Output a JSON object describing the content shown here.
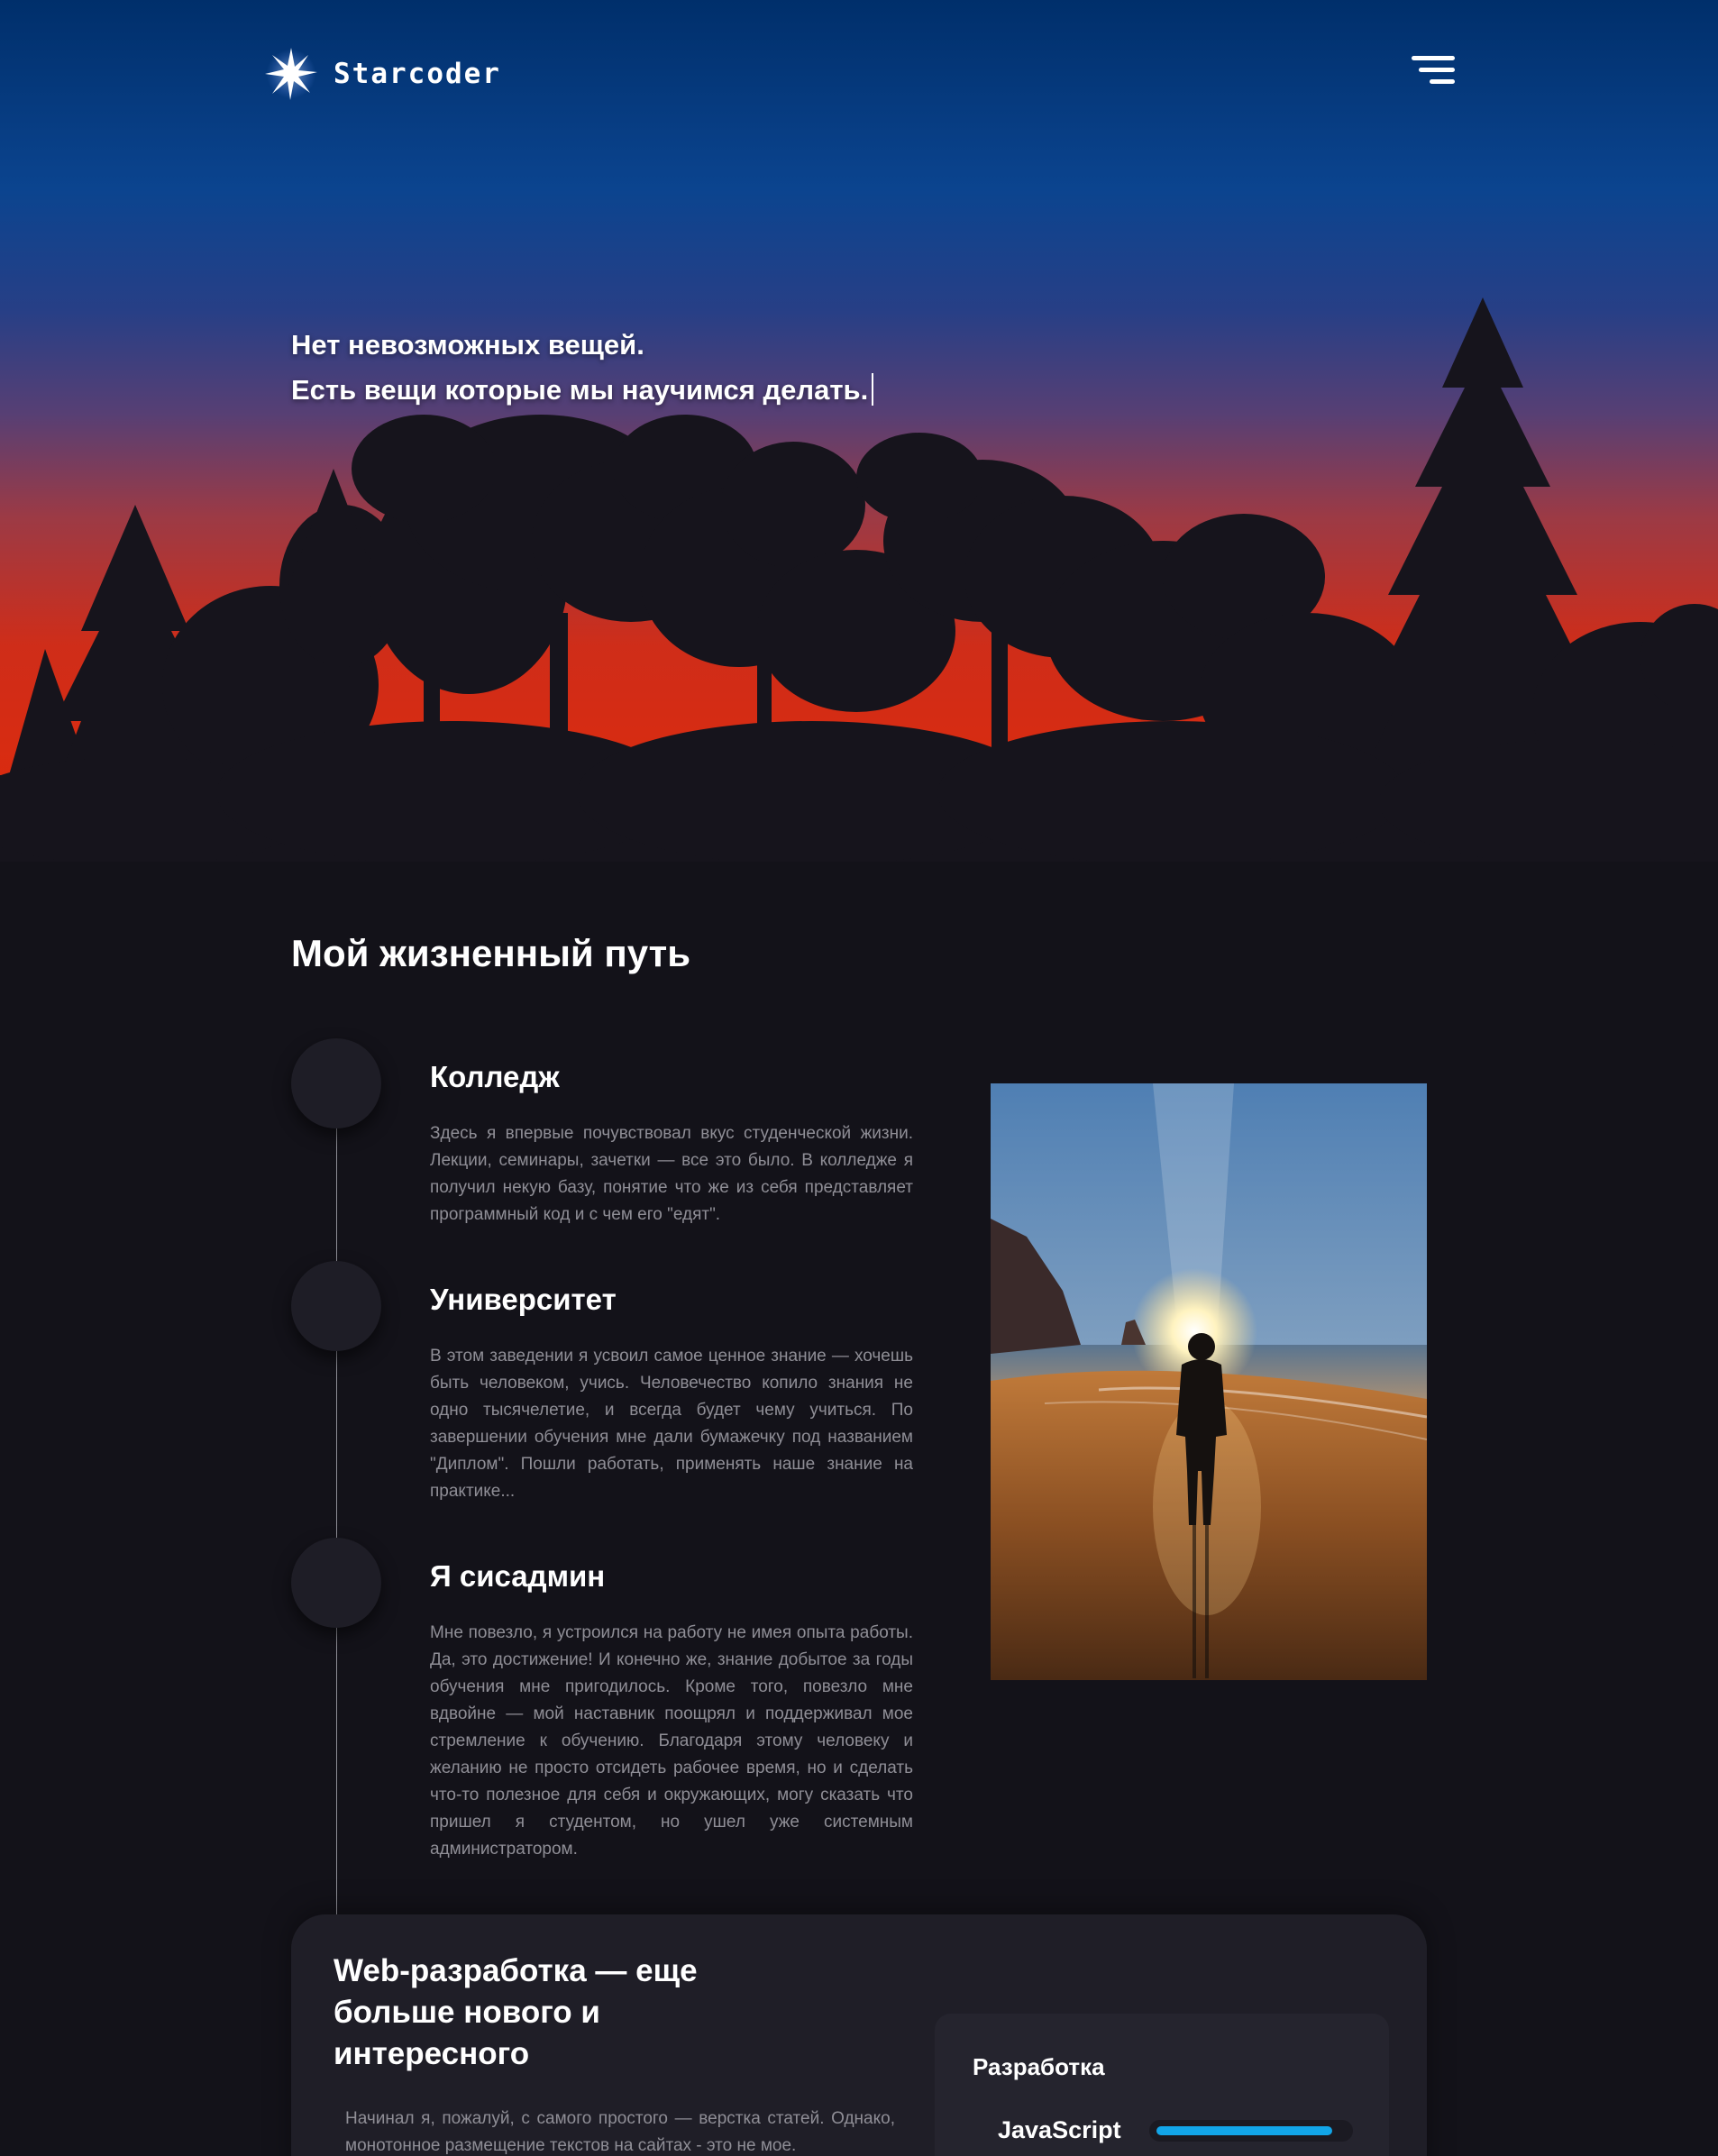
{
  "header": {
    "logo_text": "Starcoder",
    "logo_icon": "star-burst-icon",
    "menu_icon": "hamburger-menu-icon"
  },
  "hero": {
    "line1": "Нет невозможных вещей.",
    "line2": "Есть вещи которые мы научимся делать."
  },
  "life_path": {
    "title": "Мой жизненный путь",
    "items": [
      {
        "title": "Колледж",
        "text": "Здесь я впервые почувствовал вкус студенческой жизни. Лекции, семинары, зачетки — все это было. В колледже я получил некую базу, понятие что же из себя представляет программный код и с чем его \"едят\"."
      },
      {
        "title": "Университет",
        "text": "В этом заведении я усвоил самое ценное знание — хочешь быть человеком, учись. Человечество копило знания не одно тысячелетие, и всегда будет чему учиться. По завершении обучения мне дали бумажечку под названием \"Диплом\". Пошли работать, применять наше знание на практике..."
      },
      {
        "title": "Я сисадмин",
        "text": "Мне повезло, я устроился на работу не имея опыта работы. Да, это достижение! И конечно же, знание добытое за годы обучения мне пригодилось. Кроме того, повезло мне вдвойне — мой наставник поощрял и поддерживал мое стремление к обучению. Благодаря этому человеку и желанию не просто отсидеть рабочее время, но и сделать что-то полезное для себя и окружающих, могу сказать что пришел я студентом, но ушел уже системным администратором."
      }
    ]
  },
  "web_dev": {
    "title": "Web-разработка — еще больше нового и интересного",
    "text": "Начинал я, пожалуй, с самого простого — верстка статей. Однако, монотонное размещение текстов на сайтах - это не мое.",
    "skills": {
      "title": "Разработка",
      "items": [
        {
          "name": "JavaScript",
          "level": 0.93
        }
      ]
    }
  },
  "colors": {
    "background": "#131219",
    "card": "#1f1e27",
    "skill_bar": "#12a5e8",
    "muted_text": "#8f8e96"
  }
}
